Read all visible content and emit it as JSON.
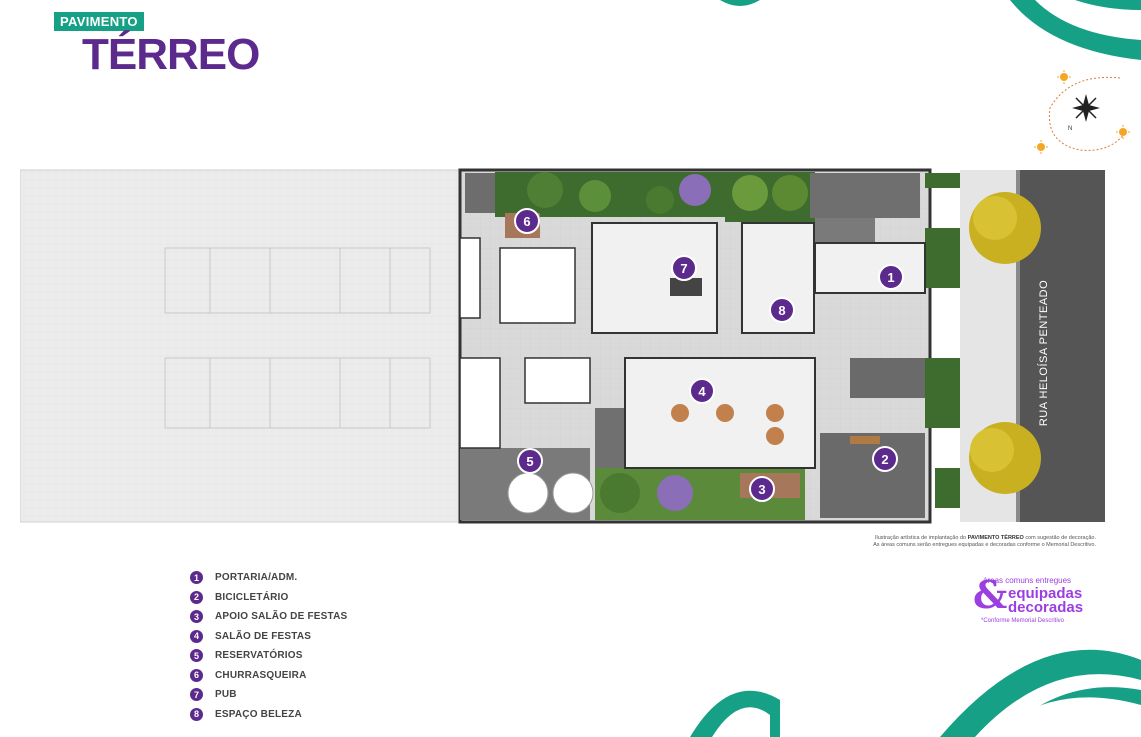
{
  "header": {
    "badge": "PAVIMENTO",
    "title": "TÉRREO"
  },
  "street": {
    "name": "RUA HELOÍSA PENTEADO"
  },
  "markers": [
    "1",
    "2",
    "3",
    "4",
    "5",
    "6",
    "7",
    "8"
  ],
  "caption": {
    "line1_pre": "Ilustração artística de implantação do ",
    "line1_bold": "PAVIMENTO TÉRREO",
    "line1_post": " com sugestão de decoração.",
    "line2": "As áreas comuns serão entregues equipadas e decoradas conforme o Memorial Descritivo."
  },
  "legend": [
    {
      "num": "1",
      "label": "PORTARIA/ADM."
    },
    {
      "num": "2",
      "label": "BICICLETÁRIO"
    },
    {
      "num": "3",
      "label": "APOIO SALÃO DE FESTAS"
    },
    {
      "num": "4",
      "label": "SALÃO DE FESTAS"
    },
    {
      "num": "5",
      "label": "RESERVATÓRIOS"
    },
    {
      "num": "6",
      "label": "CHURRASQUEIRA"
    },
    {
      "num": "7",
      "label": "PUB"
    },
    {
      "num": "8",
      "label": "ESPAÇO BELEZA"
    }
  ],
  "seal": {
    "amp": "&",
    "line1": "áreas comuns entregues",
    "line2": "equipadas",
    "line3": "decoradas",
    "line4": "*Conforme Memorial Descritivo"
  },
  "colors": {
    "purple": "#5b2a8c",
    "teal": "#16a085",
    "violet": "#9b3fe0"
  },
  "icons": [
    "compass-icon",
    "sun-icon"
  ]
}
